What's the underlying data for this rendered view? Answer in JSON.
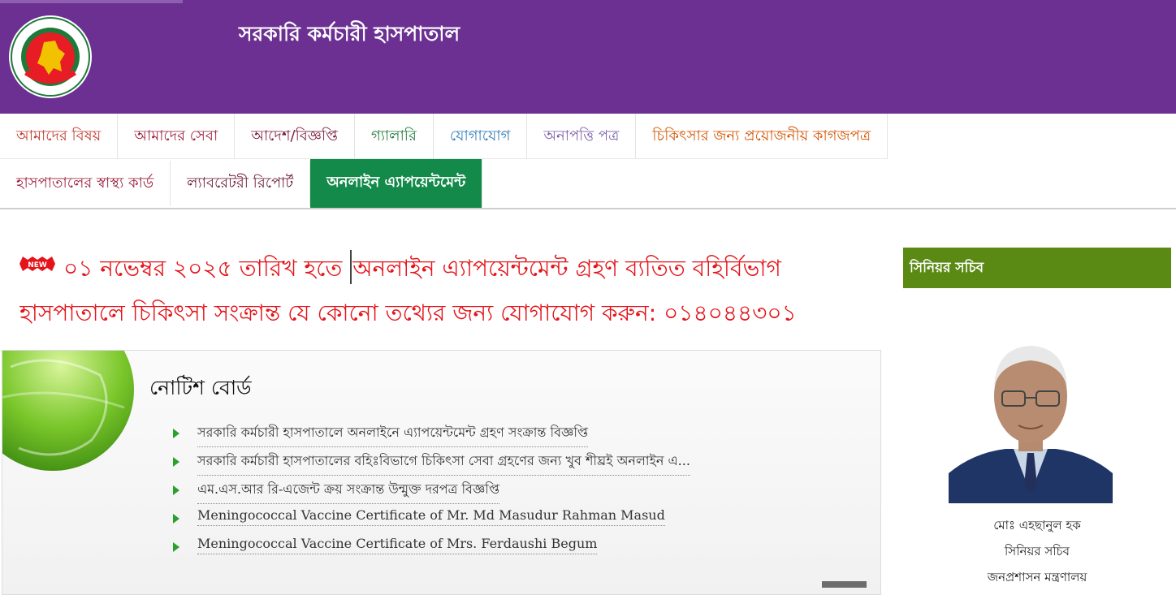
{
  "header": {
    "site_title": "সরকারি কর্মচারী হাসপাতাল",
    "logo_icon": "government-seal-icon",
    "bg_color": "#6b3091"
  },
  "nav": {
    "row1": [
      {
        "label": "আমাদের বিষয়",
        "color": "#c0392b"
      },
      {
        "label": "আমাদের সেবা",
        "color": "#9b1d3a"
      },
      {
        "label": "আদেশ/বিজ্ঞপ্তি",
        "color": "#7a1c3a"
      },
      {
        "label": "গ্যালারি",
        "color": "#1f7a3a"
      },
      {
        "label": "যোগাযোগ",
        "color": "#2f7ab5"
      },
      {
        "label": "অনাপত্তি পত্র",
        "color": "#7b5ea7"
      },
      {
        "label": "চিকিৎসার জন্য প্রয়োজনীয় কাগজপত্র",
        "color": "#d35400"
      }
    ],
    "row2": [
      {
        "label": "হাসপাতালের স্বাস্থ্য কার্ড",
        "color": "#9b1d3a"
      },
      {
        "label": "ল্যাবরেটরী রিপোর্ট",
        "color": "#6b1c33"
      },
      {
        "label": "অনলাইন এ্যাপয়েন্টমেন্ট",
        "color": "#ffffff",
        "active": true
      }
    ],
    "active_color": "#138a4a"
  },
  "marquee": {
    "badge": "NEW",
    "line1_a": "০১ নভেম্বর ২০২৫ তারিখ হতে ",
    "line1_b": "অনলাইন এ্যাপয়েন্টমেন্ট গ্রহণ ব্যতিত বহির্বিভাগ",
    "line2": "হাসপাতালে চিকিৎসা সংক্রান্ত যে কোনো তথ্যের জন্য যোগাযোগ করুন: ০১৪০৪৪৩০১",
    "color": "#e4141a"
  },
  "notice_board": {
    "title": "নোটিশ বোর্ড",
    "items": [
      "সরকারি কর্মচারী হাসপাতালে অনলাইনে এ্যাপয়েন্টমেন্ট গ্রহণ সংক্রান্ত বিজ্ঞপ্তি",
      "সরকারি কর্মচারী হাসপাতালের বহিঃবিভাগে চিকিৎসা সেবা গ্রহণের জন্য খুব শীঘ্রই অনলাইন এ...",
      "এম.এস.আর রি-এজেন্ট ক্রয় সংক্রান্ত উন্মুক্ত দরপত্র বিজ্ঞপ্তি",
      "Meningococcal Vaccine Certificate of Mr. Md Masudur Rahman Masud",
      "Meningococcal Vaccine Certificate of Mrs. Ferdaushi Begum"
    ]
  },
  "sidebar": {
    "header": "সিনিয়র সচিব",
    "header_color": "#5a8a14",
    "person_name": "মোঃ এহছানুল হক",
    "person_title": "সিনিয়র সচিব",
    "person_ministry": "জনপ্রশাসন মন্ত্রণালয়"
  }
}
